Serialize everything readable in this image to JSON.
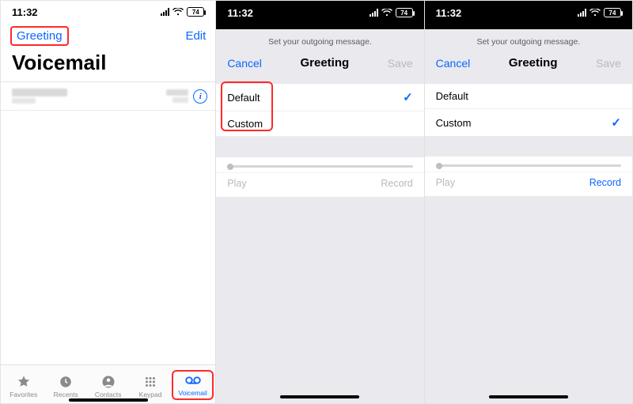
{
  "status": {
    "time": "11:32",
    "battery": "74"
  },
  "screen1": {
    "greeting_link": "Greeting",
    "edit_link": "Edit",
    "title": "Voicemail",
    "tabs": {
      "favorites": "Favorites",
      "recents": "Recents",
      "contacts": "Contacts",
      "keypad": "Keypad",
      "voicemail": "Voicemail"
    }
  },
  "sheet": {
    "subtitle": "Set your outgoing message.",
    "cancel": "Cancel",
    "title": "Greeting",
    "save": "Save",
    "option_default": "Default",
    "option_custom": "Custom",
    "play": "Play",
    "record": "Record"
  }
}
